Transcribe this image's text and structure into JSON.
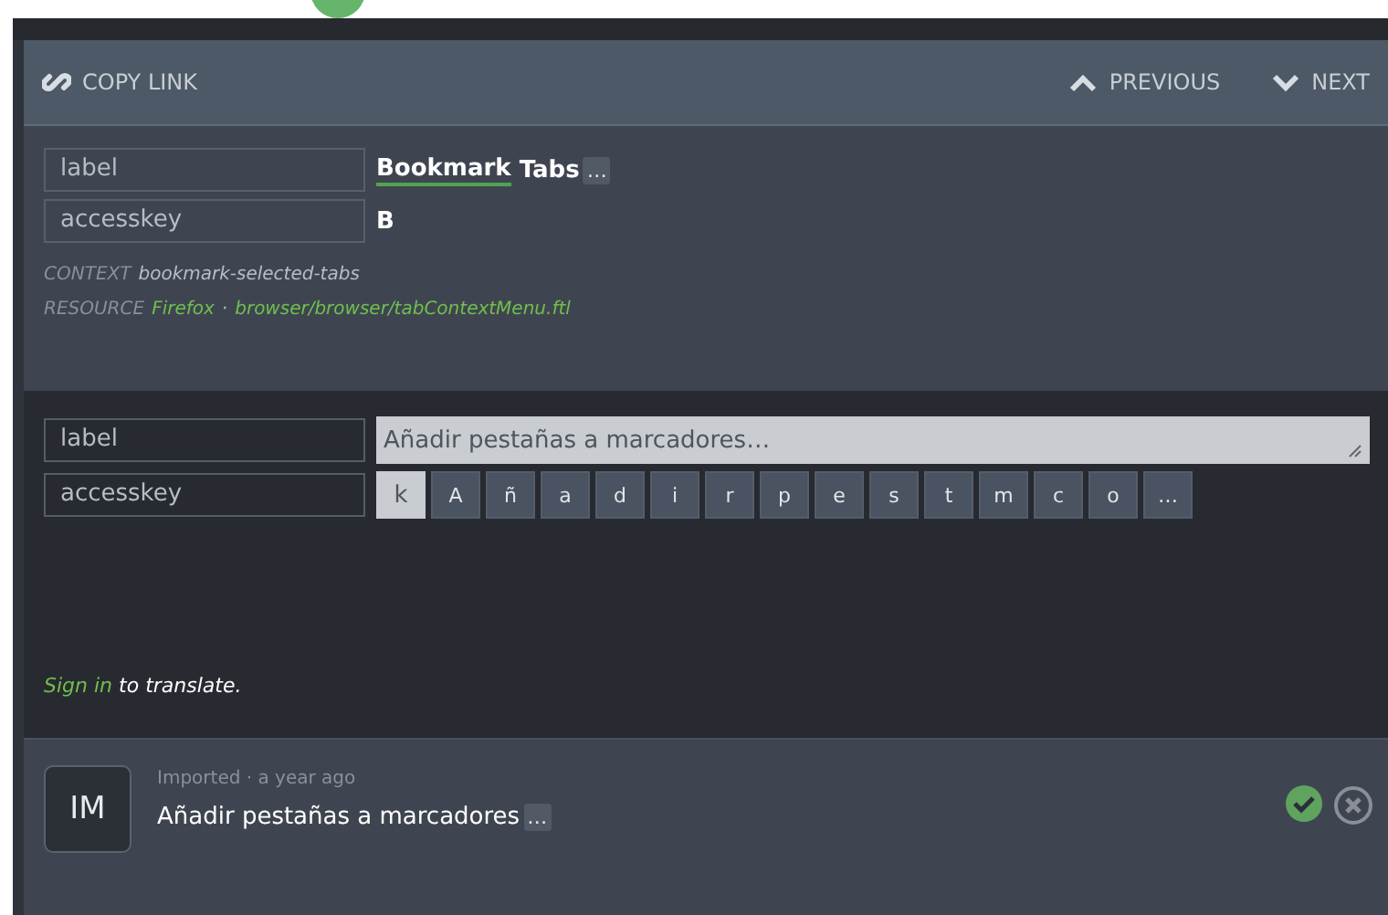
{
  "toolbar": {
    "copy_link": "COPY LINK",
    "previous": "PREVIOUS",
    "next": "NEXT"
  },
  "source": {
    "rows": [
      {
        "key": "label",
        "segments": [
          {
            "kind": "term",
            "text": "Bookmark"
          },
          {
            "kind": "plain",
            "text": " Tabs"
          },
          {
            "kind": "placeable",
            "text": "…"
          }
        ]
      },
      {
        "key": "accesskey",
        "segments": [
          {
            "kind": "plain",
            "text": "B"
          }
        ]
      }
    ],
    "context_label": "CONTEXT",
    "context": "bookmark-selected-tabs",
    "resource_label": "RESOURCE",
    "project": "Firefox",
    "separator": "·",
    "path": "browser/browser/tabContextMenu.ftl"
  },
  "editor": {
    "label_key": "label",
    "label_value": "Añadir pestañas a marcadores…",
    "accesskey_key": "accesskey",
    "keys": [
      {
        "text": "k",
        "selected": true
      },
      {
        "text": "A",
        "selected": false
      },
      {
        "text": "ñ",
        "selected": false
      },
      {
        "text": "a",
        "selected": false
      },
      {
        "text": "d",
        "selected": false
      },
      {
        "text": "i",
        "selected": false
      },
      {
        "text": "r",
        "selected": false
      },
      {
        "text": "p",
        "selected": false
      },
      {
        "text": "e",
        "selected": false
      },
      {
        "text": "s",
        "selected": false
      },
      {
        "text": "t",
        "selected": false
      },
      {
        "text": "m",
        "selected": false
      },
      {
        "text": "c",
        "selected": false
      },
      {
        "text": "o",
        "selected": false
      },
      {
        "text": "…",
        "selected": false
      }
    ],
    "sign_in": "Sign in",
    "sign_in_rest": " to translate."
  },
  "history": [
    {
      "initials": "IM",
      "meta": "Imported · a year ago",
      "text": "Añadir pestañas a marcadores",
      "placeable": "…",
      "approved": true
    }
  ]
}
